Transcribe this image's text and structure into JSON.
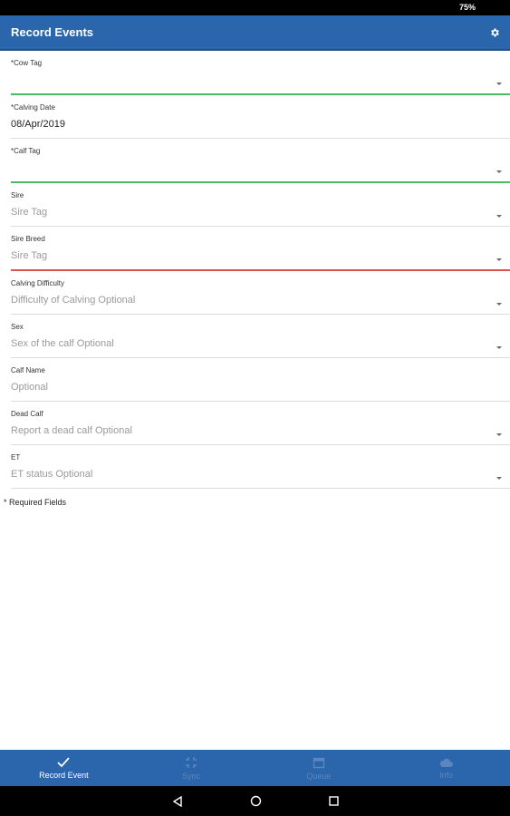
{
  "status_bar": {
    "battery": "75%"
  },
  "app_bar": {
    "title": "Record Events",
    "settings_icon": "gear-icon"
  },
  "form": {
    "cow_tag": {
      "label": "*Cow Tag",
      "value": ""
    },
    "calving_date": {
      "label": "*Calving Date",
      "value": "08/Apr/2019"
    },
    "calf_tag": {
      "label": "*Calf Tag",
      "value": ""
    },
    "sire": {
      "label": "Sire",
      "placeholder": "Sire Tag"
    },
    "sire_breed": {
      "label": "Sire Breed",
      "placeholder": "Sire Tag"
    },
    "calving_difficulty": {
      "label": "Calving Difficulty",
      "placeholder": "Difficulty of Calving Optional"
    },
    "sex": {
      "label": "Sex",
      "placeholder": "Sex of the calf Optional"
    },
    "calf_name": {
      "label": "Calf Name",
      "placeholder": "Optional"
    },
    "dead_calf": {
      "label": "Dead Calf",
      "placeholder": "Report a dead calf Optional"
    },
    "et": {
      "label": "ET",
      "placeholder": "ET status Optional"
    },
    "required_note": "* Required Fields"
  },
  "bottom_nav": {
    "items": [
      {
        "label": "Record Event",
        "icon": "check-icon",
        "active": true
      },
      {
        "label": "Sync",
        "icon": "sync-icon",
        "active": false
      },
      {
        "label": "Queue",
        "icon": "calendar-icon",
        "active": false
      },
      {
        "label": "Info",
        "icon": "cloud-icon",
        "active": false
      }
    ]
  },
  "colors": {
    "primary": "#2b66ad",
    "valid": "#4cbb67",
    "invalid": "#d9534f"
  }
}
